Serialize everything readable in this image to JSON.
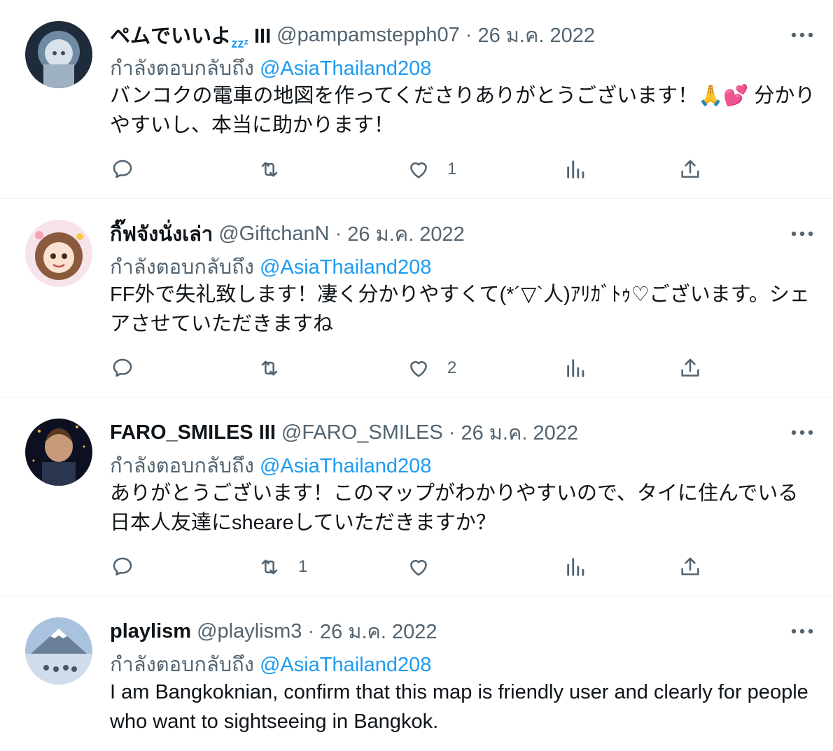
{
  "reply_prefix": "กำลังตอบกลับถึง",
  "tweets": [
    {
      "name": "ペムでいいよ",
      "name_suffix": "zzᶻ",
      "name_badge": "III",
      "handle": "@pampamstepph07",
      "date": "26 ม.ค. 2022",
      "reply_to": "@AsiaThailand208",
      "text": "バンコクの電車の地図を作ってくださりありがとうございます！🙏💕 分かりやすいし、本当に助かります！",
      "replies": "",
      "retweets": "",
      "likes": "1"
    },
    {
      "name": "กิ๊ฟจังนั่งเล่า",
      "name_suffix": "",
      "name_badge": "",
      "handle": "@GiftchanN",
      "date": "26 ม.ค. 2022",
      "reply_to": "@AsiaThailand208",
      "text": "FF外で失礼致します！凄く分かりやすくて(*´▽`人)ｱﾘｶﾞﾄｩ♡ございます。シェアさせていただきますね",
      "replies": "",
      "retweets": "",
      "likes": "2"
    },
    {
      "name": "FARO_SMILES III",
      "name_suffix": "",
      "name_badge": "",
      "handle": "@FARO_SMILES",
      "date": "26 ม.ค. 2022",
      "reply_to": "@AsiaThailand208",
      "text": "ありがとうございます！このマップがわかりやすいので、タイに住んでいる日本人友達にsheareしていただきますか？",
      "replies": "",
      "retweets": "1",
      "likes": ""
    },
    {
      "name": "playlism",
      "name_suffix": "",
      "name_badge": "",
      "handle": "@playlism3",
      "date": "26 ม.ค. 2022",
      "reply_to": "@AsiaThailand208",
      "text": "I am Bangkoknian, confirm that this map is friendly user and clearly for people who want to sightseeing in Bangkok.",
      "replies": "",
      "retweets": "",
      "likes": ""
    }
  ],
  "icons": {
    "reply": "speech-bubble-icon",
    "retweet": "retweet-arrows-icon",
    "like": "heart-icon",
    "views": "bar-chart-icon",
    "share": "upload-arrow-icon",
    "more": "ellipsis-icon"
  },
  "colors": {
    "accent": "#1d9bf0",
    "secondary_text": "#536471",
    "primary_text": "#0f1419",
    "divider": "#eff3f4"
  }
}
